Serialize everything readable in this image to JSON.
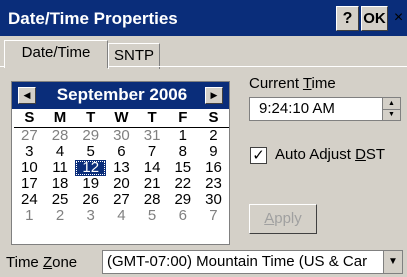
{
  "window": {
    "title": "Date/Time Properties",
    "help_label": "?",
    "ok_label": "OK",
    "close_label": "×"
  },
  "tabs": [
    {
      "label": "Date/Time",
      "selected": true
    },
    {
      "label": "SNTP",
      "selected": false
    }
  ],
  "calendar": {
    "month_label": "September 2006",
    "prev_icon": "◀",
    "next_icon": "▶",
    "weekdays": [
      "S",
      "M",
      "T",
      "W",
      "T",
      "F",
      "S"
    ],
    "weeks": [
      [
        {
          "d": "27",
          "dim": true
        },
        {
          "d": "28",
          "dim": true
        },
        {
          "d": "29",
          "dim": true
        },
        {
          "d": "30",
          "dim": true
        },
        {
          "d": "31",
          "dim": true
        },
        {
          "d": "1"
        },
        {
          "d": "2"
        }
      ],
      [
        {
          "d": "3"
        },
        {
          "d": "4"
        },
        {
          "d": "5"
        },
        {
          "d": "6"
        },
        {
          "d": "7"
        },
        {
          "d": "8"
        },
        {
          "d": "9"
        }
      ],
      [
        {
          "d": "10"
        },
        {
          "d": "11"
        },
        {
          "d": "12",
          "selected": true
        },
        {
          "d": "13"
        },
        {
          "d": "14"
        },
        {
          "d": "15"
        },
        {
          "d": "16"
        }
      ],
      [
        {
          "d": "17"
        },
        {
          "d": "18"
        },
        {
          "d": "19"
        },
        {
          "d": "20"
        },
        {
          "d": "21"
        },
        {
          "d": "22"
        },
        {
          "d": "23"
        }
      ],
      [
        {
          "d": "24"
        },
        {
          "d": "25"
        },
        {
          "d": "26"
        },
        {
          "d": "27"
        },
        {
          "d": "28"
        },
        {
          "d": "29"
        },
        {
          "d": "30"
        }
      ],
      [
        {
          "d": "1",
          "dim": true
        },
        {
          "d": "2",
          "dim": true
        },
        {
          "d": "3",
          "dim": true
        },
        {
          "d": "4",
          "dim": true
        },
        {
          "d": "5",
          "dim": true
        },
        {
          "d": "6",
          "dim": true
        },
        {
          "d": "7",
          "dim": true
        }
      ]
    ]
  },
  "current_time": {
    "label_prefix": "Current ",
    "label_accel": "T",
    "label_suffix": "ime",
    "value": "9:24:10 AM"
  },
  "dst": {
    "checked": true,
    "check_glyph": "✓",
    "label_prefix": "Auto Adjust ",
    "label_accel": "D",
    "label_suffix": "ST"
  },
  "apply": {
    "accel": "A",
    "rest": "pply"
  },
  "timezone": {
    "label_prefix": "Time ",
    "label_accel": "Z",
    "label_suffix": "one",
    "value": "(GMT-07:00) Mountain Time (US & Car",
    "arrow_icon": "▼"
  },
  "colors": {
    "titlebar": "#0a2d7a",
    "face": "#d4d0c8"
  }
}
